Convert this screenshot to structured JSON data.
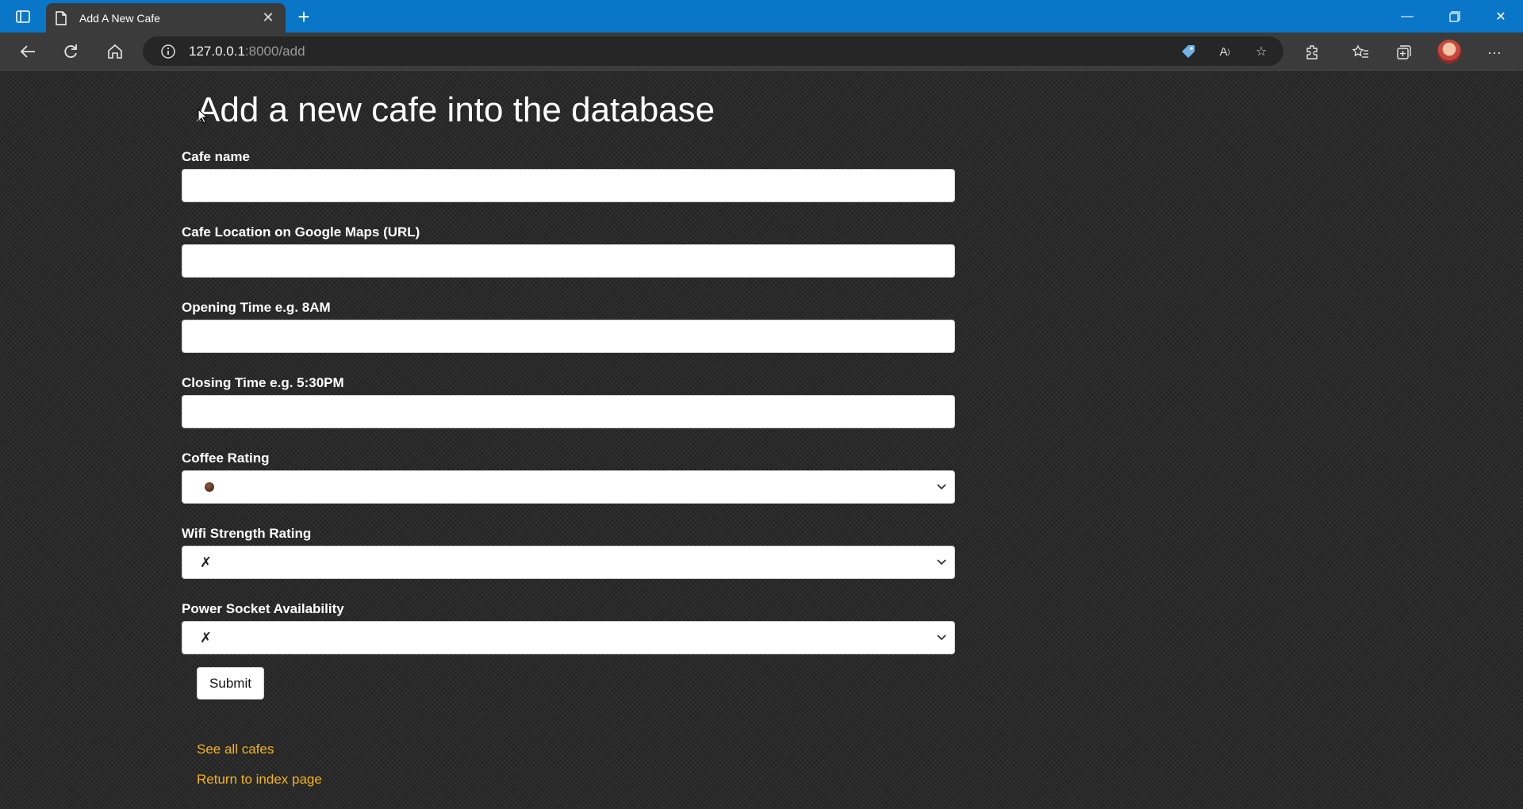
{
  "browser": {
    "tab_title": "Add A New Cafe",
    "url_host": "127.0.0.1",
    "url_path": ":8000/add"
  },
  "page": {
    "title": "Add a new cafe into the database",
    "fields": [
      {
        "label": "Cafe name",
        "value": ""
      },
      {
        "label": "Cafe Location on Google Maps (URL)",
        "value": ""
      },
      {
        "label": "Opening Time e.g. 8AM",
        "value": ""
      },
      {
        "label": "Closing Time e.g. 5:30PM",
        "value": ""
      }
    ],
    "selects": [
      {
        "label": "Coffee Rating",
        "selected": "☕"
      },
      {
        "label": "Wifi Strength Rating",
        "selected": "✗"
      },
      {
        "label": "Power Socket Availability",
        "selected": "✗"
      }
    ],
    "submit_label": "Submit",
    "links": {
      "see_all": "See all cafes",
      "return_index": "Return to index page"
    }
  },
  "colors": {
    "tab_bar": "#0a76c8",
    "link": "#f2b51e"
  }
}
